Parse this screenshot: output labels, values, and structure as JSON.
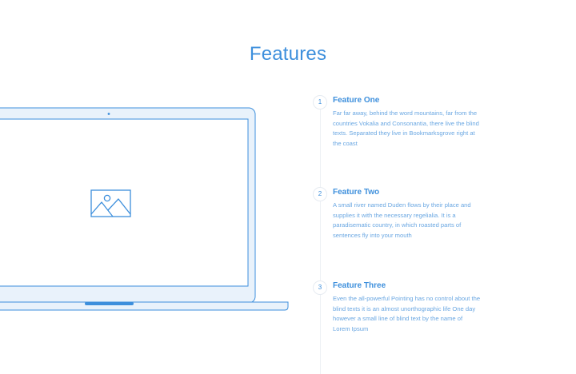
{
  "section": {
    "title": "Features"
  },
  "image_placeholder": {
    "icon": "image-icon"
  },
  "features": [
    {
      "number": "1",
      "title": "Feature One",
      "text": "Far far away, behind the word mountains, far from the countries Vokalia and Consonantia, there live the blind texts. Separated they live in Bookmarksgrove right at the coast"
    },
    {
      "number": "2",
      "title": "Feature Two",
      "text": "A small river named Duden flows by their place and supplies it with the necessary regelialia. It is a paradisematic country, in which roasted parts of sentences fly into your mouth"
    },
    {
      "number": "3",
      "title": "Feature Three",
      "text": "Even the all-powerful Pointing has no control about the blind texts it is an almost unorthographic life One day however a small line of blind text by the name of Lorem Ipsum"
    }
  ],
  "colors": {
    "accent": "#3d8fdc",
    "text": "#6aa7e2",
    "screen_fill": "#e9f2fb",
    "line": "#eef1f5"
  }
}
